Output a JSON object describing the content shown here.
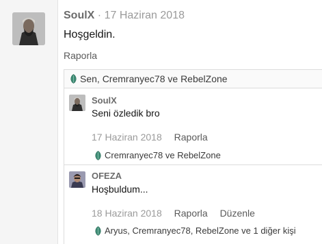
{
  "post": {
    "username": "SoulX",
    "separator": "·",
    "date": "17 Haziran 2018",
    "body": "Hoşgeldin.",
    "report_label": "Raporla",
    "likes_text": "Sen, Cremranyec78 ve RebelZone"
  },
  "replies": [
    {
      "username": "SoulX",
      "text": "Seni özledik bro",
      "date": "17 Haziran 2018",
      "report_label": "Raporla",
      "likes_text": "Cremranyec78 ve RebelZone"
    },
    {
      "username": "OFEZA",
      "text": "Hoşbuldum...",
      "date": "18 Haziran 2018",
      "report_label": "Raporla",
      "edit_label": "Düzenle",
      "likes_text": "Aryus, Cremranyec78, RebelZone ve 1 diğer kişi"
    }
  ],
  "icons": {
    "like": "leaf-icon",
    "like_color": "#3e8a74"
  }
}
